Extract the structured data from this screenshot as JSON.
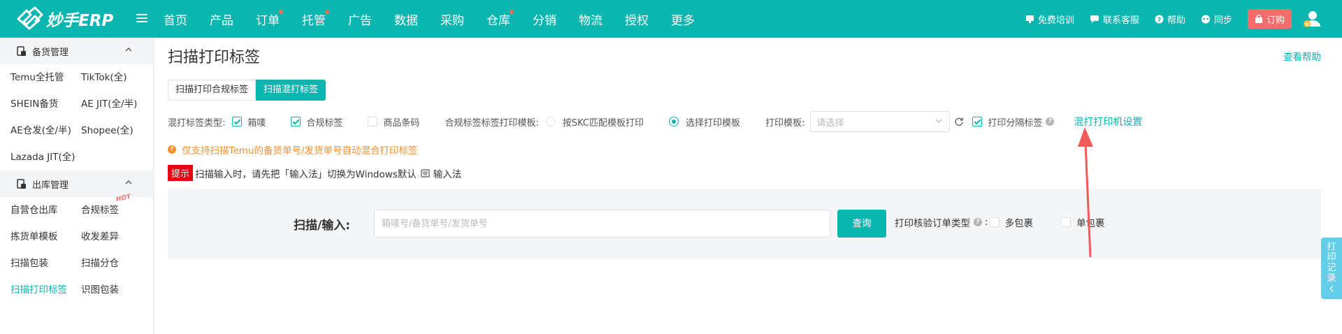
{
  "header": {
    "logo_text": "妙手ERP",
    "nav": [
      {
        "label": "首页",
        "dot": false
      },
      {
        "label": "产品",
        "dot": false
      },
      {
        "label": "订单",
        "dot": true
      },
      {
        "label": "托管",
        "dot": true
      },
      {
        "label": "广告",
        "dot": false
      },
      {
        "label": "数据",
        "dot": false
      },
      {
        "label": "采购",
        "dot": false
      },
      {
        "label": "仓库",
        "dot": true
      },
      {
        "label": "分销",
        "dot": false
      },
      {
        "label": "物流",
        "dot": false
      },
      {
        "label": "授权",
        "dot": false
      },
      {
        "label": "更多",
        "dot": false
      }
    ],
    "tools": {
      "training": "免费培训",
      "service": "联系客服",
      "help": "帮助",
      "sync": "同步",
      "order": "订购"
    }
  },
  "sidebar": {
    "groups": [
      {
        "title": "备货管理",
        "items": [
          "Temu全托管",
          "TikTok(全)",
          "SHEIN备货",
          "AE JIT(全/半)",
          "AE仓发(全/半)",
          "Shopee(全)",
          "Lazada JIT(全)"
        ]
      },
      {
        "title": "出库管理",
        "items": [
          "自营仓出库",
          "合规标签",
          "拣货单模板",
          "收发差异",
          "扫描包装",
          "扫描分仓",
          "扫描打印标签",
          "识图包装"
        ]
      }
    ],
    "hot_badge": "HOT"
  },
  "main": {
    "title": "扫描打印标签",
    "help_link": "查看帮助",
    "tabs": [
      {
        "label": "扫描打印合规标签",
        "active": false
      },
      {
        "label": "扫描混打标签",
        "active": true
      }
    ],
    "options": {
      "type_label": "混打标签类型:",
      "type_checkboxes": [
        {
          "label": "箱唛",
          "checked": true
        },
        {
          "label": "合规标签",
          "checked": true
        },
        {
          "label": "商品条码",
          "checked": false
        }
      ],
      "template_mode_label": "合规标签标签打印模板:",
      "template_radios": [
        {
          "label": "按SKC匹配模板打印",
          "checked": false
        },
        {
          "label": "选择打印模板",
          "checked": true
        }
      ],
      "print_template_label": "打印模板:",
      "print_template_placeholder": "请选择",
      "separator_label": "打印分隔标签",
      "separator_checked": true,
      "printer_settings_link": "混打打印机设置"
    },
    "notice": "仅支持扫描Temu的备货单号/发货单号自动混合打印标签",
    "tip": {
      "badge": "提示",
      "text": "扫描输入时，请先把「输入法」切换为Windows默认",
      "suffix": "输入法"
    },
    "scan": {
      "label": "扫描/输入:",
      "placeholder": "箱唛号/备货单号/发货单号",
      "query_button": "查询",
      "verify_label": "打印核验订单类型",
      "verify_options": [
        {
          "label": "多包裹",
          "checked": false
        },
        {
          "label": "单包裹",
          "checked": false
        }
      ]
    }
  },
  "print_record": "打印记录",
  "colors": {
    "brand": "#0bb5b0",
    "danger": "#f56c6c",
    "warning": "#f5902f",
    "annotation_arrow": "#f25a5a"
  }
}
